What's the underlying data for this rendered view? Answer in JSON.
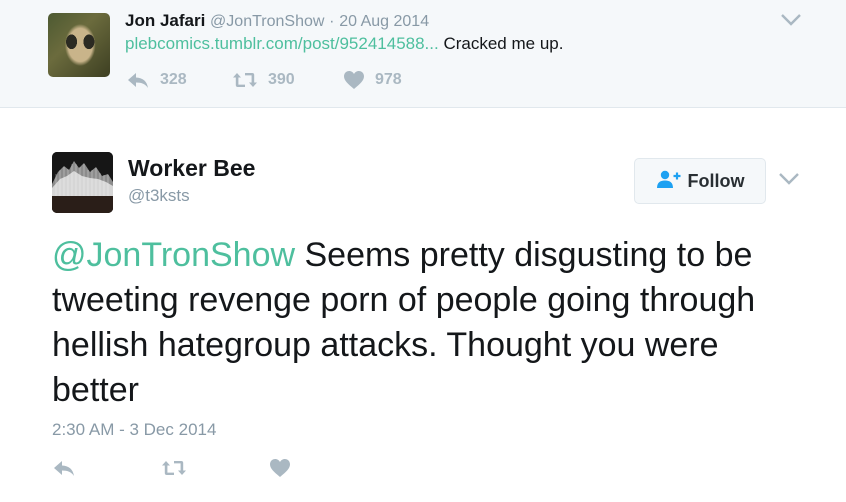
{
  "parent_tweet": {
    "author_name": "Jon Jafari",
    "author_handle": "@JonTronShow",
    "separator": "·",
    "date": "20 Aug 2014",
    "link_text": "plebcomics.tumblr.com/post/952414588...",
    "text": " Cracked me up.",
    "reply_count": "328",
    "retweet_count": "390",
    "like_count": "978"
  },
  "tweet": {
    "author_name": "Worker Bee",
    "author_handle": "@t3ksts",
    "follow_label": "Follow",
    "mention": "@JonTronShow",
    "text": " Seems pretty disgusting to be tweeting revenge porn of people going through hellish hategroup attacks. Thought you were better",
    "timestamp": "2:30 AM - 3 Dec 2014"
  },
  "icons": {
    "reply": "reply-icon",
    "retweet": "retweet-icon",
    "like": "heart-icon",
    "more": "chevron-down-icon",
    "follow": "add-user-icon"
  },
  "colors": {
    "link": "#4ebf9e",
    "muted": "#8899a6",
    "action": "#aab8c2",
    "parent_bg": "#f5f8fa"
  }
}
